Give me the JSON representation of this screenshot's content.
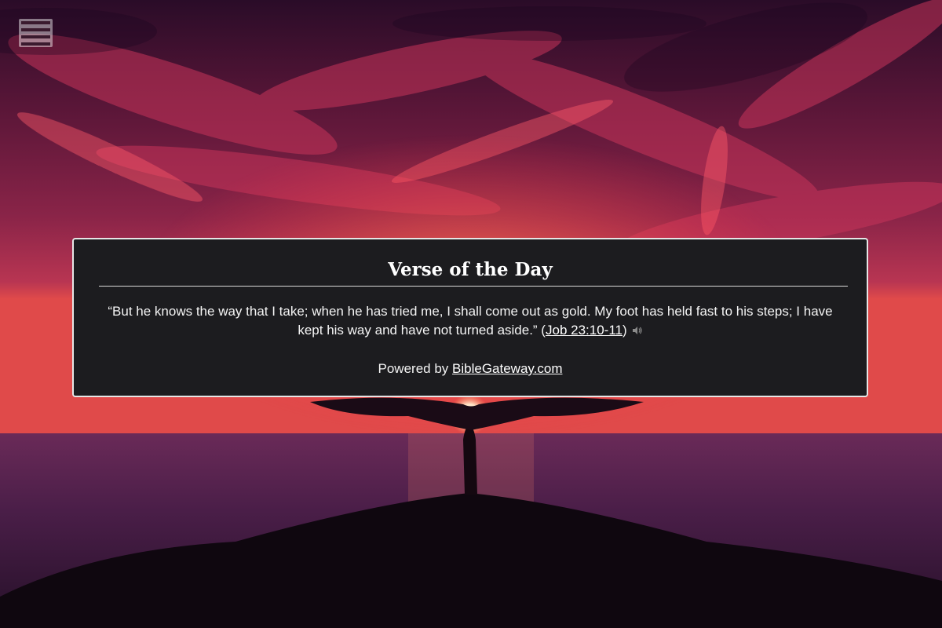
{
  "background": {
    "description_icon": "sunset-tree-photo",
    "sky_colors": [
      "#3a1030",
      "#7a1f45",
      "#c23a5a",
      "#ff5a3a"
    ],
    "sea_color": "#3b1a3e",
    "sun_color": "#fff2d8"
  },
  "menu": {
    "icon": "hamburger-menu-icon"
  },
  "verse_of_the_day": {
    "title": "Verse of the Day",
    "verse_text": "“But he knows the way that I take; when he has tried me, I shall come out as gold. My foot has held fast to his steps; I have kept his way and have not turned aside.” (",
    "reference": "Job 23:10-11",
    "reference_suffix": ")",
    "audio_icon": "speaker-icon",
    "powered_by_label": "Powered by ",
    "powered_by_link": "BibleGateway.com"
  }
}
